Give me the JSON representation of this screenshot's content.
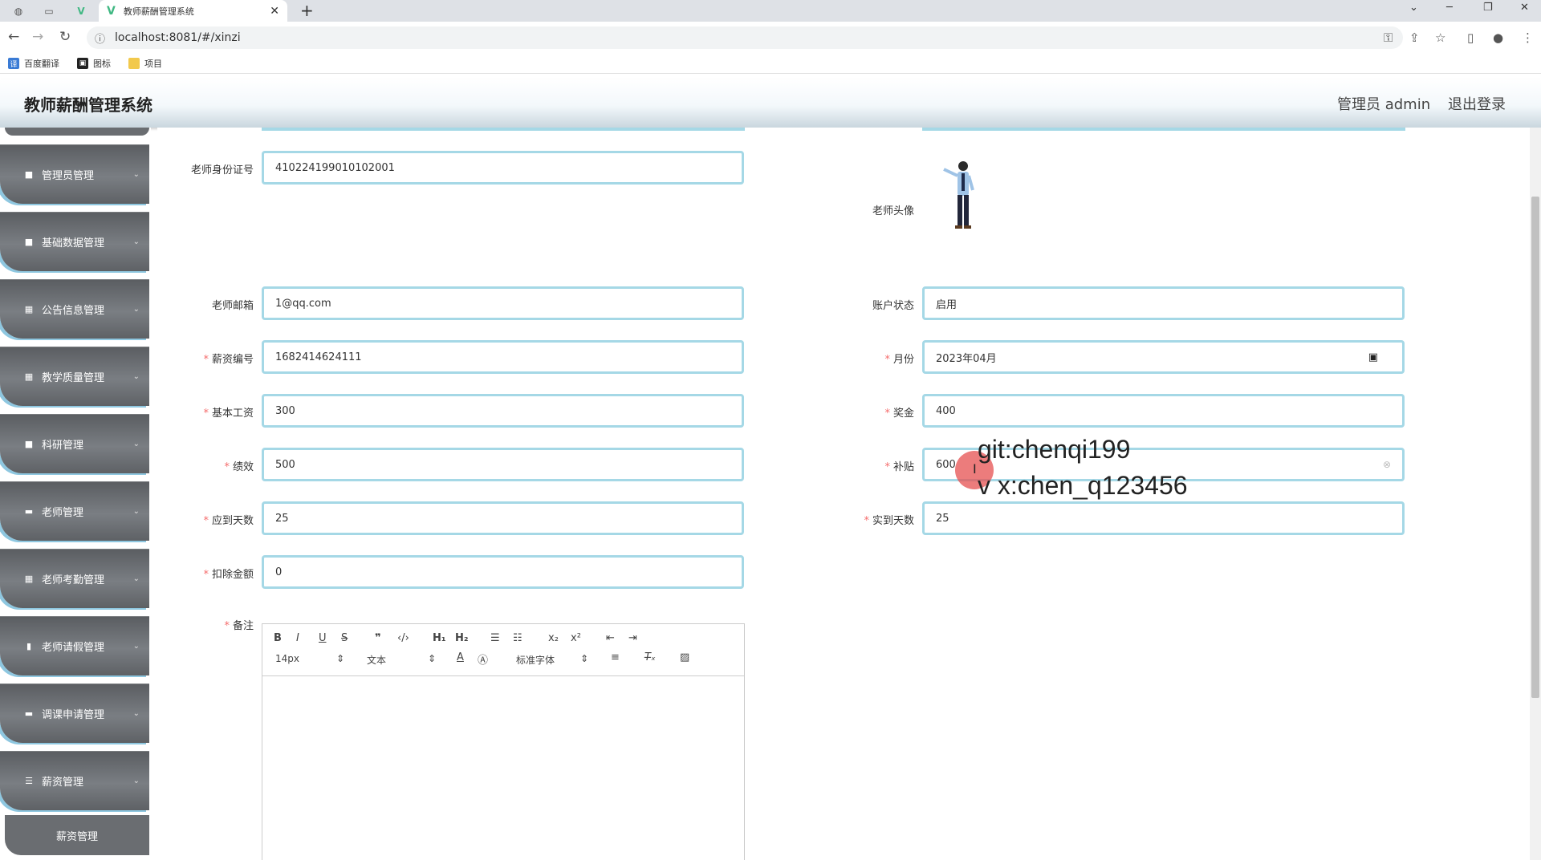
{
  "browser": {
    "tab_title": "教师薪酬管理系统",
    "url": "localhost:8081/#/xinzi",
    "bookmarks": [
      {
        "label": "百度翻译",
        "icon": "translate-icon",
        "color": "#3a7bd5"
      },
      {
        "label": "图标",
        "icon": "image-icon",
        "color": "#222222"
      },
      {
        "label": "项目",
        "icon": "folder-icon",
        "color": "#f2c94c"
      }
    ]
  },
  "header": {
    "title": "教师薪酬管理系统",
    "user": "管理员 admin",
    "logout": "退出登录"
  },
  "sidebar": {
    "items": [
      {
        "label": "管理员管理",
        "icon": "user-icon"
      },
      {
        "label": "基础数据管理",
        "icon": "clipboard-icon"
      },
      {
        "label": "公告信息管理",
        "icon": "grid-icon"
      },
      {
        "label": "教学质量管理",
        "icon": "grid-icon"
      },
      {
        "label": "科研管理",
        "icon": "clipboard-icon"
      },
      {
        "label": "老师管理",
        "icon": "monitor-icon"
      },
      {
        "label": "老师考勤管理",
        "icon": "grid-icon"
      },
      {
        "label": "老师请假管理",
        "icon": "chart-icon"
      },
      {
        "label": "调课申请管理",
        "icon": "monitor-icon"
      },
      {
        "label": "薪资管理",
        "icon": "sliders-icon"
      }
    ],
    "sub_item": "薪资管理"
  },
  "form": {
    "id_card_label": "老师身份证号",
    "id_card_value": "410224199010102001",
    "avatar_label": "老师头像",
    "email_label": "老师邮箱",
    "email_value": "1@qq.com",
    "status_label": "账户状态",
    "status_value": "启用",
    "salary_no_label": "薪资编号",
    "salary_no_value": "1682414624111",
    "month_label": "月份",
    "month_value": "2023年04月",
    "base_label": "基本工资",
    "base_value": "300",
    "bonus_label": "奖金",
    "bonus_value": "400",
    "perf_label": "绩效",
    "perf_value": "500",
    "subsidy_label": "补贴",
    "subsidy_value": "600",
    "due_days_label": "应到天数",
    "due_days_value": "25",
    "actual_days_label": "实到天数",
    "actual_days_value": "25",
    "deduct_label": "扣除金额",
    "deduct_value": "0",
    "remark_label": "备注"
  },
  "editor": {
    "font_size": "14px",
    "paragraph": "文本",
    "font_family": "标准字体"
  },
  "watermark": {
    "line1": "git:chenqi199",
    "line2": "v x:chen_q123456"
  }
}
